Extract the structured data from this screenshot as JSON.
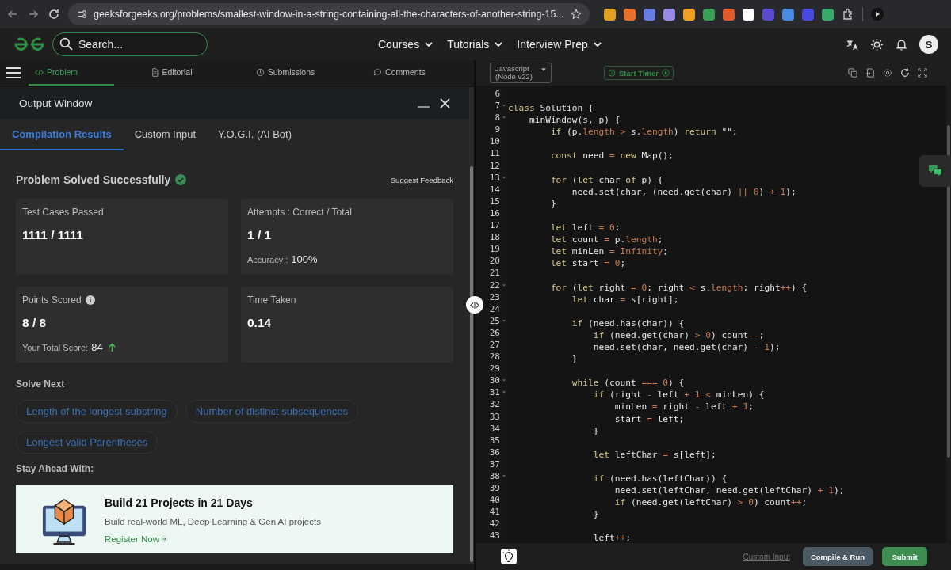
{
  "browser": {
    "url": "geeksforgeeks.org/problems/smallest-window-in-a-string-containing-all-the-characters-of-another-string-15..."
  },
  "nav": {
    "search_placeholder": "Search...",
    "menus": [
      "Courses",
      "Tutorials",
      "Interview Prep"
    ],
    "avatar": "S"
  },
  "problem_tabs": [
    {
      "label": "Problem",
      "selected": true
    },
    {
      "label": "Editorial",
      "selected": false
    },
    {
      "label": "Submissions",
      "selected": false
    },
    {
      "label": "Comments",
      "selected": false
    }
  ],
  "output_window": {
    "title": "Output Window",
    "tabs": [
      {
        "label": "Compilation Results",
        "selected": true
      },
      {
        "label": "Custom Input",
        "selected": false
      },
      {
        "label": "Y.O.G.I. (AI Bot)",
        "selected": false
      }
    ],
    "status": "Problem Solved Successfully",
    "feedback": "Suggest Feedback",
    "cards": [
      {
        "kind": "plain",
        "label": "Test Cases Passed",
        "value": "1111 / 1111"
      },
      {
        "kind": "plain",
        "label": "Attempts : Correct / Total",
        "value": "1 / 1",
        "sub_label": "Accuracy :",
        "sub_value": "100%"
      },
      {
        "kind": "points",
        "label": "Points Scored",
        "value": "8 / 8",
        "sub_label": "Your Total Score:",
        "sub_value": "84"
      },
      {
        "kind": "plain",
        "label": "Time Taken",
        "value": "0.14"
      }
    ],
    "solve_next": {
      "title": "Solve Next",
      "items": [
        "Length of the longest substring",
        "Number of distinct subsequences",
        "Longest valid Parentheses"
      ]
    },
    "promo": {
      "heading": "Stay Ahead With:",
      "title": "Build 21 Projects in 21 Days",
      "text": "Build real-world ML, Deep Learning & Gen AI projects",
      "link": "Register Now"
    }
  },
  "editor": {
    "language": [
      "Javascript",
      "(Node v22)"
    ],
    "timer": "Start Timer",
    "lines": [
      {
        "n": "6",
        "fold": false
      },
      {
        "n": "7",
        "fold": true,
        "t": [
          {
            "kind": "kw",
            "text": "class"
          },
          {
            "kind": "plain",
            "text": " Solution {"
          }
        ]
      },
      {
        "n": "8",
        "fold": true,
        "t": [
          {
            "kind": "plain",
            "text": "    minWindow(s, p) {"
          }
        ]
      },
      {
        "n": "9",
        "fold": false,
        "t": [
          {
            "kind": "kw",
            "text": "        if"
          },
          {
            "kind": "plain",
            "text": " (p."
          },
          {
            "kind": "op",
            "text": "length"
          },
          {
            "kind": "op",
            "text": " >"
          },
          {
            "kind": "plain",
            "text": " s."
          },
          {
            "kind": "op",
            "text": "length"
          },
          {
            "kind": "plain",
            "text": ") "
          },
          {
            "kind": "kw",
            "text": "return"
          },
          {
            "kind": "plain",
            "text": " \"\";"
          }
        ]
      },
      {
        "n": "10",
        "fold": false
      },
      {
        "n": "11",
        "fold": false,
        "t": [
          {
            "kind": "kw",
            "text": "        const"
          },
          {
            "kind": "plain",
            "text": " need "
          },
          {
            "kind": "op",
            "text": "="
          },
          {
            "kind": "kw",
            "text": " new"
          },
          {
            "kind": "plain",
            "text": " Map();"
          }
        ]
      },
      {
        "n": "12",
        "fold": false
      },
      {
        "n": "13",
        "fold": true,
        "t": [
          {
            "kind": "kw",
            "text": "        for"
          },
          {
            "kind": "plain",
            "text": " ("
          },
          {
            "kind": "kw",
            "text": "let"
          },
          {
            "kind": "plain",
            "text": " char "
          },
          {
            "kind": "kw",
            "text": "of"
          },
          {
            "kind": "plain",
            "text": " p) {"
          }
        ]
      },
      {
        "n": "14",
        "fold": false,
        "t": [
          {
            "kind": "plain",
            "text": "            need.set(char, (need.get(char) "
          },
          {
            "kind": "op",
            "text": "||"
          },
          {
            "kind": "op",
            "text": " 0"
          },
          {
            "kind": "plain",
            "text": ") "
          },
          {
            "kind": "op",
            "text": "+"
          },
          {
            "kind": "op",
            "text": " 1"
          },
          {
            "kind": "plain",
            "text": ");"
          }
        ]
      },
      {
        "n": "15",
        "fold": false,
        "t": [
          {
            "kind": "plain",
            "text": "        }"
          }
        ]
      },
      {
        "n": "16",
        "fold": false
      },
      {
        "n": "17",
        "fold": false,
        "t": [
          {
            "kind": "kw",
            "text": "        let"
          },
          {
            "kind": "plain",
            "text": " left "
          },
          {
            "kind": "op",
            "text": "="
          },
          {
            "kind": "op",
            "text": " 0"
          },
          {
            "kind": "plain",
            "text": ";"
          }
        ]
      },
      {
        "n": "18",
        "fold": false,
        "t": [
          {
            "kind": "kw",
            "text": "        let"
          },
          {
            "kind": "plain",
            "text": " count "
          },
          {
            "kind": "op",
            "text": "="
          },
          {
            "kind": "plain",
            "text": " p."
          },
          {
            "kind": "op",
            "text": "length"
          },
          {
            "kind": "plain",
            "text": ";"
          }
        ]
      },
      {
        "n": "19",
        "fold": false,
        "t": [
          {
            "kind": "kw",
            "text": "        let"
          },
          {
            "kind": "plain",
            "text": " minLen "
          },
          {
            "kind": "op",
            "text": "="
          },
          {
            "kind": "op",
            "text": " Infinity"
          },
          {
            "kind": "plain",
            "text": ";"
          }
        ]
      },
      {
        "n": "20",
        "fold": false,
        "t": [
          {
            "kind": "kw",
            "text": "        let"
          },
          {
            "kind": "plain",
            "text": " start "
          },
          {
            "kind": "op",
            "text": "="
          },
          {
            "kind": "op",
            "text": " 0"
          },
          {
            "kind": "plain",
            "text": ";"
          }
        ]
      },
      {
        "n": "21",
        "fold": false
      },
      {
        "n": "22",
        "fold": true,
        "t": [
          {
            "kind": "kw",
            "text": "        for"
          },
          {
            "kind": "plain",
            "text": " ("
          },
          {
            "kind": "kw",
            "text": "let"
          },
          {
            "kind": "plain",
            "text": " right "
          },
          {
            "kind": "op",
            "text": "="
          },
          {
            "kind": "op",
            "text": " 0"
          },
          {
            "kind": "plain",
            "text": "; right "
          },
          {
            "kind": "op",
            "text": "<"
          },
          {
            "kind": "plain",
            "text": " s."
          },
          {
            "kind": "op",
            "text": "length"
          },
          {
            "kind": "plain",
            "text": "; right"
          },
          {
            "kind": "op",
            "text": "++"
          },
          {
            "kind": "plain",
            "text": ") {"
          }
        ]
      },
      {
        "n": "23",
        "fold": false,
        "t": [
          {
            "kind": "kw",
            "text": "            let"
          },
          {
            "kind": "plain",
            "text": " char "
          },
          {
            "kind": "op",
            "text": "="
          },
          {
            "kind": "plain",
            "text": " s[right];"
          }
        ]
      },
      {
        "n": "24",
        "fold": false
      },
      {
        "n": "25",
        "fold": true,
        "t": [
          {
            "kind": "kw",
            "text": "            if"
          },
          {
            "kind": "plain",
            "text": " (need.has(char)) {"
          }
        ]
      },
      {
        "n": "26",
        "fold": false,
        "t": [
          {
            "kind": "kw",
            "text": "                if"
          },
          {
            "kind": "plain",
            "text": " (need.get(char) "
          },
          {
            "kind": "op",
            "text": ">"
          },
          {
            "kind": "op",
            "text": " 0"
          },
          {
            "kind": "plain",
            "text": ") count"
          },
          {
            "kind": "op",
            "text": "--"
          },
          {
            "kind": "plain",
            "text": ";"
          }
        ]
      },
      {
        "n": "27",
        "fold": false,
        "t": [
          {
            "kind": "plain",
            "text": "                need.set(char, need.get(char) "
          },
          {
            "kind": "op",
            "text": "-"
          },
          {
            "kind": "op",
            "text": " 1"
          },
          {
            "kind": "plain",
            "text": ");"
          }
        ]
      },
      {
        "n": "28",
        "fold": false,
        "t": [
          {
            "kind": "plain",
            "text": "            }"
          }
        ]
      },
      {
        "n": "29",
        "fold": false
      },
      {
        "n": "30",
        "fold": true,
        "t": [
          {
            "kind": "kw",
            "text": "            while"
          },
          {
            "kind": "plain",
            "text": " (count "
          },
          {
            "kind": "op",
            "text": "==="
          },
          {
            "kind": "op",
            "text": " 0"
          },
          {
            "kind": "plain",
            "text": ") {"
          }
        ]
      },
      {
        "n": "31",
        "fold": true,
        "t": [
          {
            "kind": "kw",
            "text": "                if"
          },
          {
            "kind": "plain",
            "text": " (right "
          },
          {
            "kind": "op",
            "text": "-"
          },
          {
            "kind": "plain",
            "text": " left "
          },
          {
            "kind": "op",
            "text": "+"
          },
          {
            "kind": "op",
            "text": " 1"
          },
          {
            "kind": "op",
            "text": " <"
          },
          {
            "kind": "plain",
            "text": " minLen) {"
          }
        ]
      },
      {
        "n": "32",
        "fold": false,
        "t": [
          {
            "kind": "plain",
            "text": "                    minLen "
          },
          {
            "kind": "op",
            "text": "="
          },
          {
            "kind": "plain",
            "text": " right "
          },
          {
            "kind": "op",
            "text": "-"
          },
          {
            "kind": "plain",
            "text": " left "
          },
          {
            "kind": "op",
            "text": "+"
          },
          {
            "kind": "op",
            "text": " 1"
          },
          {
            "kind": "plain",
            "text": ";"
          }
        ]
      },
      {
        "n": "33",
        "fold": false,
        "t": [
          {
            "kind": "plain",
            "text": "                    start "
          },
          {
            "kind": "op",
            "text": "="
          },
          {
            "kind": "plain",
            "text": " left;"
          }
        ]
      },
      {
        "n": "34",
        "fold": false,
        "t": [
          {
            "kind": "plain",
            "text": "                }"
          }
        ]
      },
      {
        "n": "35",
        "fold": false
      },
      {
        "n": "36",
        "fold": false,
        "t": [
          {
            "kind": "kw",
            "text": "                let"
          },
          {
            "kind": "plain",
            "text": " leftChar "
          },
          {
            "kind": "op",
            "text": "="
          },
          {
            "kind": "plain",
            "text": " s[left];"
          }
        ]
      },
      {
        "n": "37",
        "fold": false
      },
      {
        "n": "38",
        "fold": true,
        "t": [
          {
            "kind": "kw",
            "text": "                if"
          },
          {
            "kind": "plain",
            "text": " (need.has(leftChar)) {"
          }
        ]
      },
      {
        "n": "39",
        "fold": false,
        "t": [
          {
            "kind": "plain",
            "text": "                    need.set(leftChar, need.get(leftChar) "
          },
          {
            "kind": "op",
            "text": "+"
          },
          {
            "kind": "op",
            "text": " 1"
          },
          {
            "kind": "plain",
            "text": ");"
          }
        ]
      },
      {
        "n": "40",
        "fold": false,
        "t": [
          {
            "kind": "kw",
            "text": "                    if"
          },
          {
            "kind": "plain",
            "text": " (need.get(leftChar) "
          },
          {
            "kind": "op",
            "text": ">"
          },
          {
            "kind": "op",
            "text": " 0"
          },
          {
            "kind": "plain",
            "text": ") count"
          },
          {
            "kind": "op",
            "text": "++"
          },
          {
            "kind": "plain",
            "text": ";"
          }
        ]
      },
      {
        "n": "41",
        "fold": false,
        "t": [
          {
            "kind": "plain",
            "text": "                }"
          }
        ]
      },
      {
        "n": "42",
        "fold": false
      },
      {
        "n": "43",
        "fold": false,
        "t": [
          {
            "kind": "plain",
            "text": "                left"
          },
          {
            "kind": "op",
            "text": "++"
          },
          {
            "kind": "plain",
            "text": ";"
          }
        ]
      }
    ],
    "custom_input": "Custom Input",
    "compile": "Compile & Run",
    "submit": "Submit"
  }
}
